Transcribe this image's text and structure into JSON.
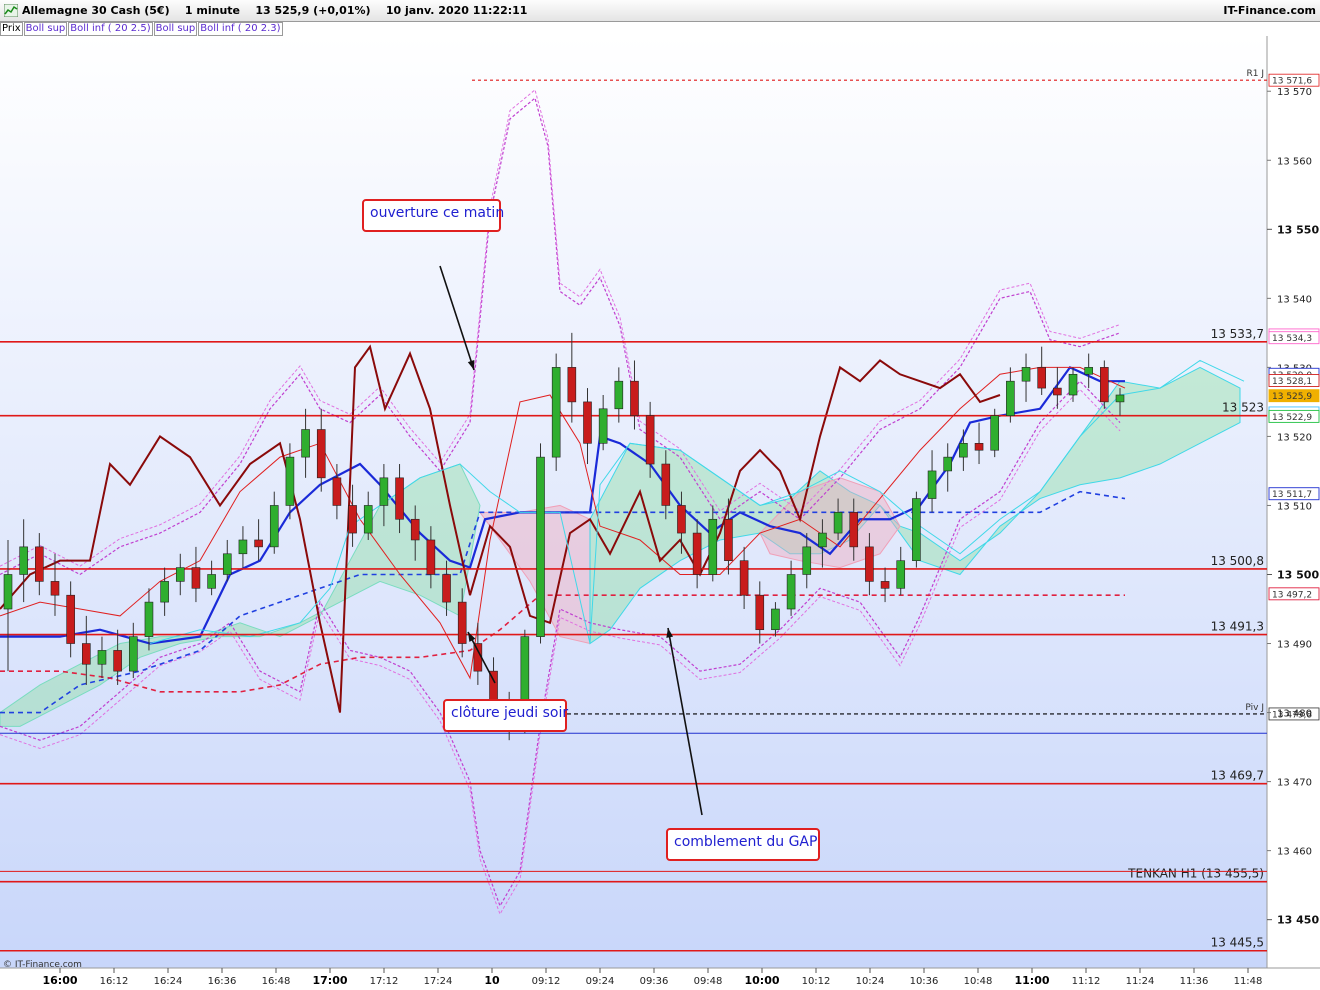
{
  "window": {
    "title": "Allemagne 30 Cash (5€)    1 minute    13 525,9 (+0,01%)    10 janv. 2020 11:22:11",
    "brand": "IT-Finance.com",
    "copyright": "© IT-Finance.com"
  },
  "legend": [
    "Prix",
    "Boll sup",
    "Boll inf ( 20 2.5)",
    "Boll sup",
    "Boll inf ( 20 2.3)"
  ],
  "annotations": [
    {
      "text": "ouverture ce matin"
    },
    {
      "text": "clôture jeudi soir"
    },
    {
      "text": "comblement du GAP"
    }
  ],
  "chart_data": {
    "type": "candlestick",
    "instrument": "Allemagne 30 Cash (5€)",
    "timeframe": "1 minute",
    "last_price": 13525.9,
    "ylim": [
      13443,
      13578
    ],
    "y_ticks_major": [
      13450,
      13500,
      13550
    ],
    "y_ticks_minor": [
      13460,
      13470,
      13480,
      13490,
      13510,
      13520,
      13530,
      13540,
      13560,
      13570
    ],
    "x_ticks": [
      {
        "label": "16:00",
        "bold": true
      },
      {
        "label": "16:12"
      },
      {
        "label": "16:24"
      },
      {
        "label": "16:36"
      },
      {
        "label": "16:48"
      },
      {
        "label": "17:00",
        "bold": true
      },
      {
        "label": "17:12"
      },
      {
        "label": "17:24"
      },
      {
        "label": "10",
        "bold": true
      },
      {
        "label": "09:12"
      },
      {
        "label": "09:24"
      },
      {
        "label": "09:36"
      },
      {
        "label": "09:48"
      },
      {
        "label": "10:00",
        "bold": true
      },
      {
        "label": "10:12"
      },
      {
        "label": "10:24"
      },
      {
        "label": "10:36"
      },
      {
        "label": "10:48"
      },
      {
        "label": "11:00",
        "bold": true
      },
      {
        "label": "11:12"
      },
      {
        "label": "11:24"
      },
      {
        "label": "11:36"
      },
      {
        "label": "11:48"
      }
    ],
    "levels": [
      {
        "value": 13533.7,
        "label": "13 533,7"
      },
      {
        "value": 13523,
        "label": "13 523"
      },
      {
        "value": 13500.8,
        "label": "13 500,8"
      },
      {
        "value": 13491.3,
        "label": "13 491,3"
      },
      {
        "value": 13469.7,
        "label": "13 469,7"
      },
      {
        "value": 13455.5,
        "label": "TENKAN H1 (13 455,5)"
      },
      {
        "value": 13445.5,
        "label": "13 445,5"
      }
    ],
    "pivots": [
      {
        "value": 13571.6,
        "label": "R1 J",
        "tag": "13 571,6"
      },
      {
        "value": 13479.8,
        "label": "Piv J",
        "tag": "13 479,8"
      }
    ],
    "right_tags": [
      {
        "value": 13534.7,
        "text": "13 534,7",
        "color": "#ff66cc"
      },
      {
        "value": 13534.3,
        "text": "13 534,3",
        "color": "#ff66cc"
      },
      {
        "value": 13529.0,
        "text": "13 529,0",
        "color": "#2030d0"
      },
      {
        "value": 13528.1,
        "text": "13 528,1",
        "color": "#d02020"
      },
      {
        "value": 13525.9,
        "text": "13 525,9",
        "color": "#f0b000",
        "current": true
      },
      {
        "value": 13523.4,
        "text": "13 523,4",
        "color": "#40c0ff"
      },
      {
        "value": 13522.9,
        "text": "13 522,9",
        "color": "#20c040"
      },
      {
        "value": 13511.7,
        "text": "13 511,7",
        "color": "#2030d0"
      },
      {
        "value": 13497.2,
        "text": "13 497,2",
        "color": "#e02040"
      }
    ],
    "candles": [
      [
        13495,
        13505,
        13486,
        13500
      ],
      [
        13500,
        13508,
        13496,
        13504
      ],
      [
        13504,
        13506,
        13497,
        13499
      ],
      [
        13499,
        13503,
        13494,
        13497
      ],
      [
        13497,
        13499,
        13488,
        13490
      ],
      [
        13490,
        13494,
        13484,
        13487
      ],
      [
        13487,
        13491,
        13485,
        13489
      ],
      [
        13489,
        13492,
        13484,
        13486
      ],
      [
        13486,
        13493,
        13485,
        13491
      ],
      [
        13491,
        13498,
        13489,
        13496
      ],
      [
        13496,
        13501,
        13494,
        13499
      ],
      [
        13499,
        13503,
        13497,
        13501
      ],
      [
        13501,
        13504,
        13496,
        13498
      ],
      [
        13498,
        13502,
        13497,
        13500
      ],
      [
        13500,
        13505,
        13499,
        13503
      ],
      [
        13503,
        13507,
        13501,
        13505
      ],
      [
        13505,
        13508,
        13502,
        13504
      ],
      [
        13504,
        13512,
        13503,
        13510
      ],
      [
        13510,
        13519,
        13508,
        13517
      ],
      [
        13517,
        13524,
        13514,
        13521
      ],
      [
        13521,
        13524,
        13512,
        13514
      ],
      [
        13514,
        13516,
        13508,
        13510
      ],
      [
        13510,
        13513,
        13504,
        13506
      ],
      [
        13506,
        13512,
        13505,
        13510
      ],
      [
        13510,
        13516,
        13507,
        13514
      ],
      [
        13514,
        13516,
        13506,
        13508
      ],
      [
        13508,
        13510,
        13502,
        13505
      ],
      [
        13505,
        13507,
        13498,
        13500
      ],
      [
        13500,
        13502,
        13494,
        13496
      ],
      [
        13496,
        13498,
        13488,
        13490
      ],
      [
        13490,
        13493,
        13484,
        13486
      ],
      [
        13486,
        13488,
        13478,
        13480
      ],
      [
        13480,
        13483,
        13476,
        13478
      ],
      [
        13478,
        13492,
        13477,
        13491
      ],
      [
        13491,
        13519,
        13490,
        13517
      ],
      [
        13517,
        13532,
        13515,
        13530
      ],
      [
        13530,
        13535,
        13522,
        13525
      ],
      [
        13525,
        13527,
        13516,
        13519
      ],
      [
        13519,
        13526,
        13518,
        13524
      ],
      [
        13524,
        13530,
        13522,
        13528
      ],
      [
        13528,
        13531,
        13521,
        13523
      ],
      [
        13523,
        13525,
        13514,
        13516
      ],
      [
        13516,
        13518,
        13508,
        13510
      ],
      [
        13510,
        13512,
        13503,
        13506
      ],
      [
        13506,
        13508,
        13498,
        13500
      ],
      [
        13500,
        13510,
        13499,
        13508
      ],
      [
        13508,
        13511,
        13500,
        13502
      ],
      [
        13502,
        13504,
        13495,
        13497
      ],
      [
        13497,
        13499,
        13490,
        13492
      ],
      [
        13492,
        13496,
        13491,
        13495
      ],
      [
        13495,
        13502,
        13494,
        13500
      ],
      [
        13500,
        13506,
        13498,
        13504
      ],
      [
        13504,
        13508,
        13501,
        13506
      ],
      [
        13506,
        13511,
        13505,
        13509
      ],
      [
        13509,
        13511,
        13502,
        13504
      ],
      [
        13504,
        13506,
        13497,
        13499
      ],
      [
        13499,
        13501,
        13496,
        13498
      ],
      [
        13498,
        13504,
        13497,
        13502
      ],
      [
        13502,
        13512,
        13501,
        13511
      ],
      [
        13511,
        13518,
        13509,
        13515
      ],
      [
        13515,
        13519,
        13512,
        13517
      ],
      [
        13517,
        13521,
        13515,
        13519
      ],
      [
        13519,
        13522,
        13516,
        13518
      ],
      [
        13518,
        13524,
        13517,
        13523
      ],
      [
        13523,
        13530,
        13522,
        13528
      ],
      [
        13528,
        13532,
        13525,
        13530
      ],
      [
        13530,
        13533,
        13526,
        13527
      ],
      [
        13527,
        13530,
        13524,
        13526
      ],
      [
        13526,
        13530,
        13525,
        13529
      ],
      [
        13529,
        13532,
        13527,
        13530
      ],
      [
        13530,
        13531,
        13524,
        13525
      ],
      [
        13525,
        13527,
        13523,
        13526
      ]
    ],
    "bollinger_note": "Bollinger bands (20, 2.5) and (20, 2.3), Ichimoku cloud, moving averages"
  }
}
